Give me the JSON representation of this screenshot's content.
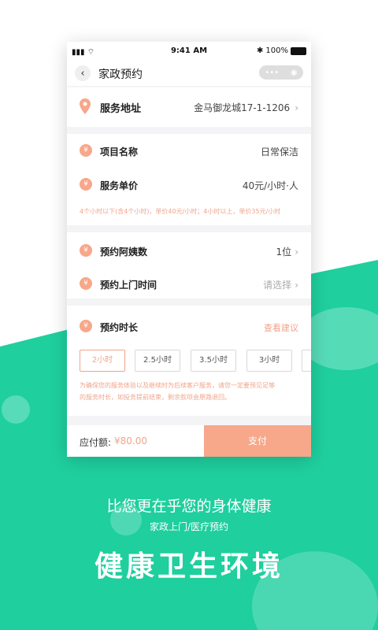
{
  "status_bar": {
    "time": "9:41 AM",
    "battery": "100%"
  },
  "nav": {
    "back_icon": "chevron-left-icon",
    "title": "家政预约",
    "capsule_more": "•••",
    "capsule_close": "◉"
  },
  "address": {
    "label": "服务地址",
    "value": "金马御龙城17-1-1206",
    "icon": "location-pin-icon"
  },
  "project": {
    "label": "项目名称",
    "value": "日常保洁"
  },
  "price": {
    "label": "服务单价",
    "value": "40元/小时·人",
    "note": "4个小时以下(含4个小时)，单价40元/小时；4小时以上，单价35元/小时"
  },
  "workers": {
    "label": "预约阿姨数",
    "value": "1位"
  },
  "visit_time": {
    "label": "预约上门时间",
    "value": "请选择"
  },
  "duration": {
    "label": "预约时长",
    "link": "查看建议",
    "options": [
      "2小时",
      "2.5小时",
      "3.5小时",
      "3小时"
    ],
    "selected": "2小时",
    "note_line1": "为确保您的服务体验以及继续时为后续客户服务，请您一定要预见足够",
    "note_line2": "的服务时长，如投务提前结束，剩余款项会原路退回。"
  },
  "payment": {
    "label": "应付额:",
    "amount": "¥80.00",
    "button": "支付"
  },
  "promo": {
    "line1": "比您更在乎您的身体健康",
    "line2": "家政上门/医疗预约",
    "headline": "健康卫生环境"
  },
  "colors": {
    "accent": "#f7a78a",
    "green": "#1fcf9e"
  }
}
